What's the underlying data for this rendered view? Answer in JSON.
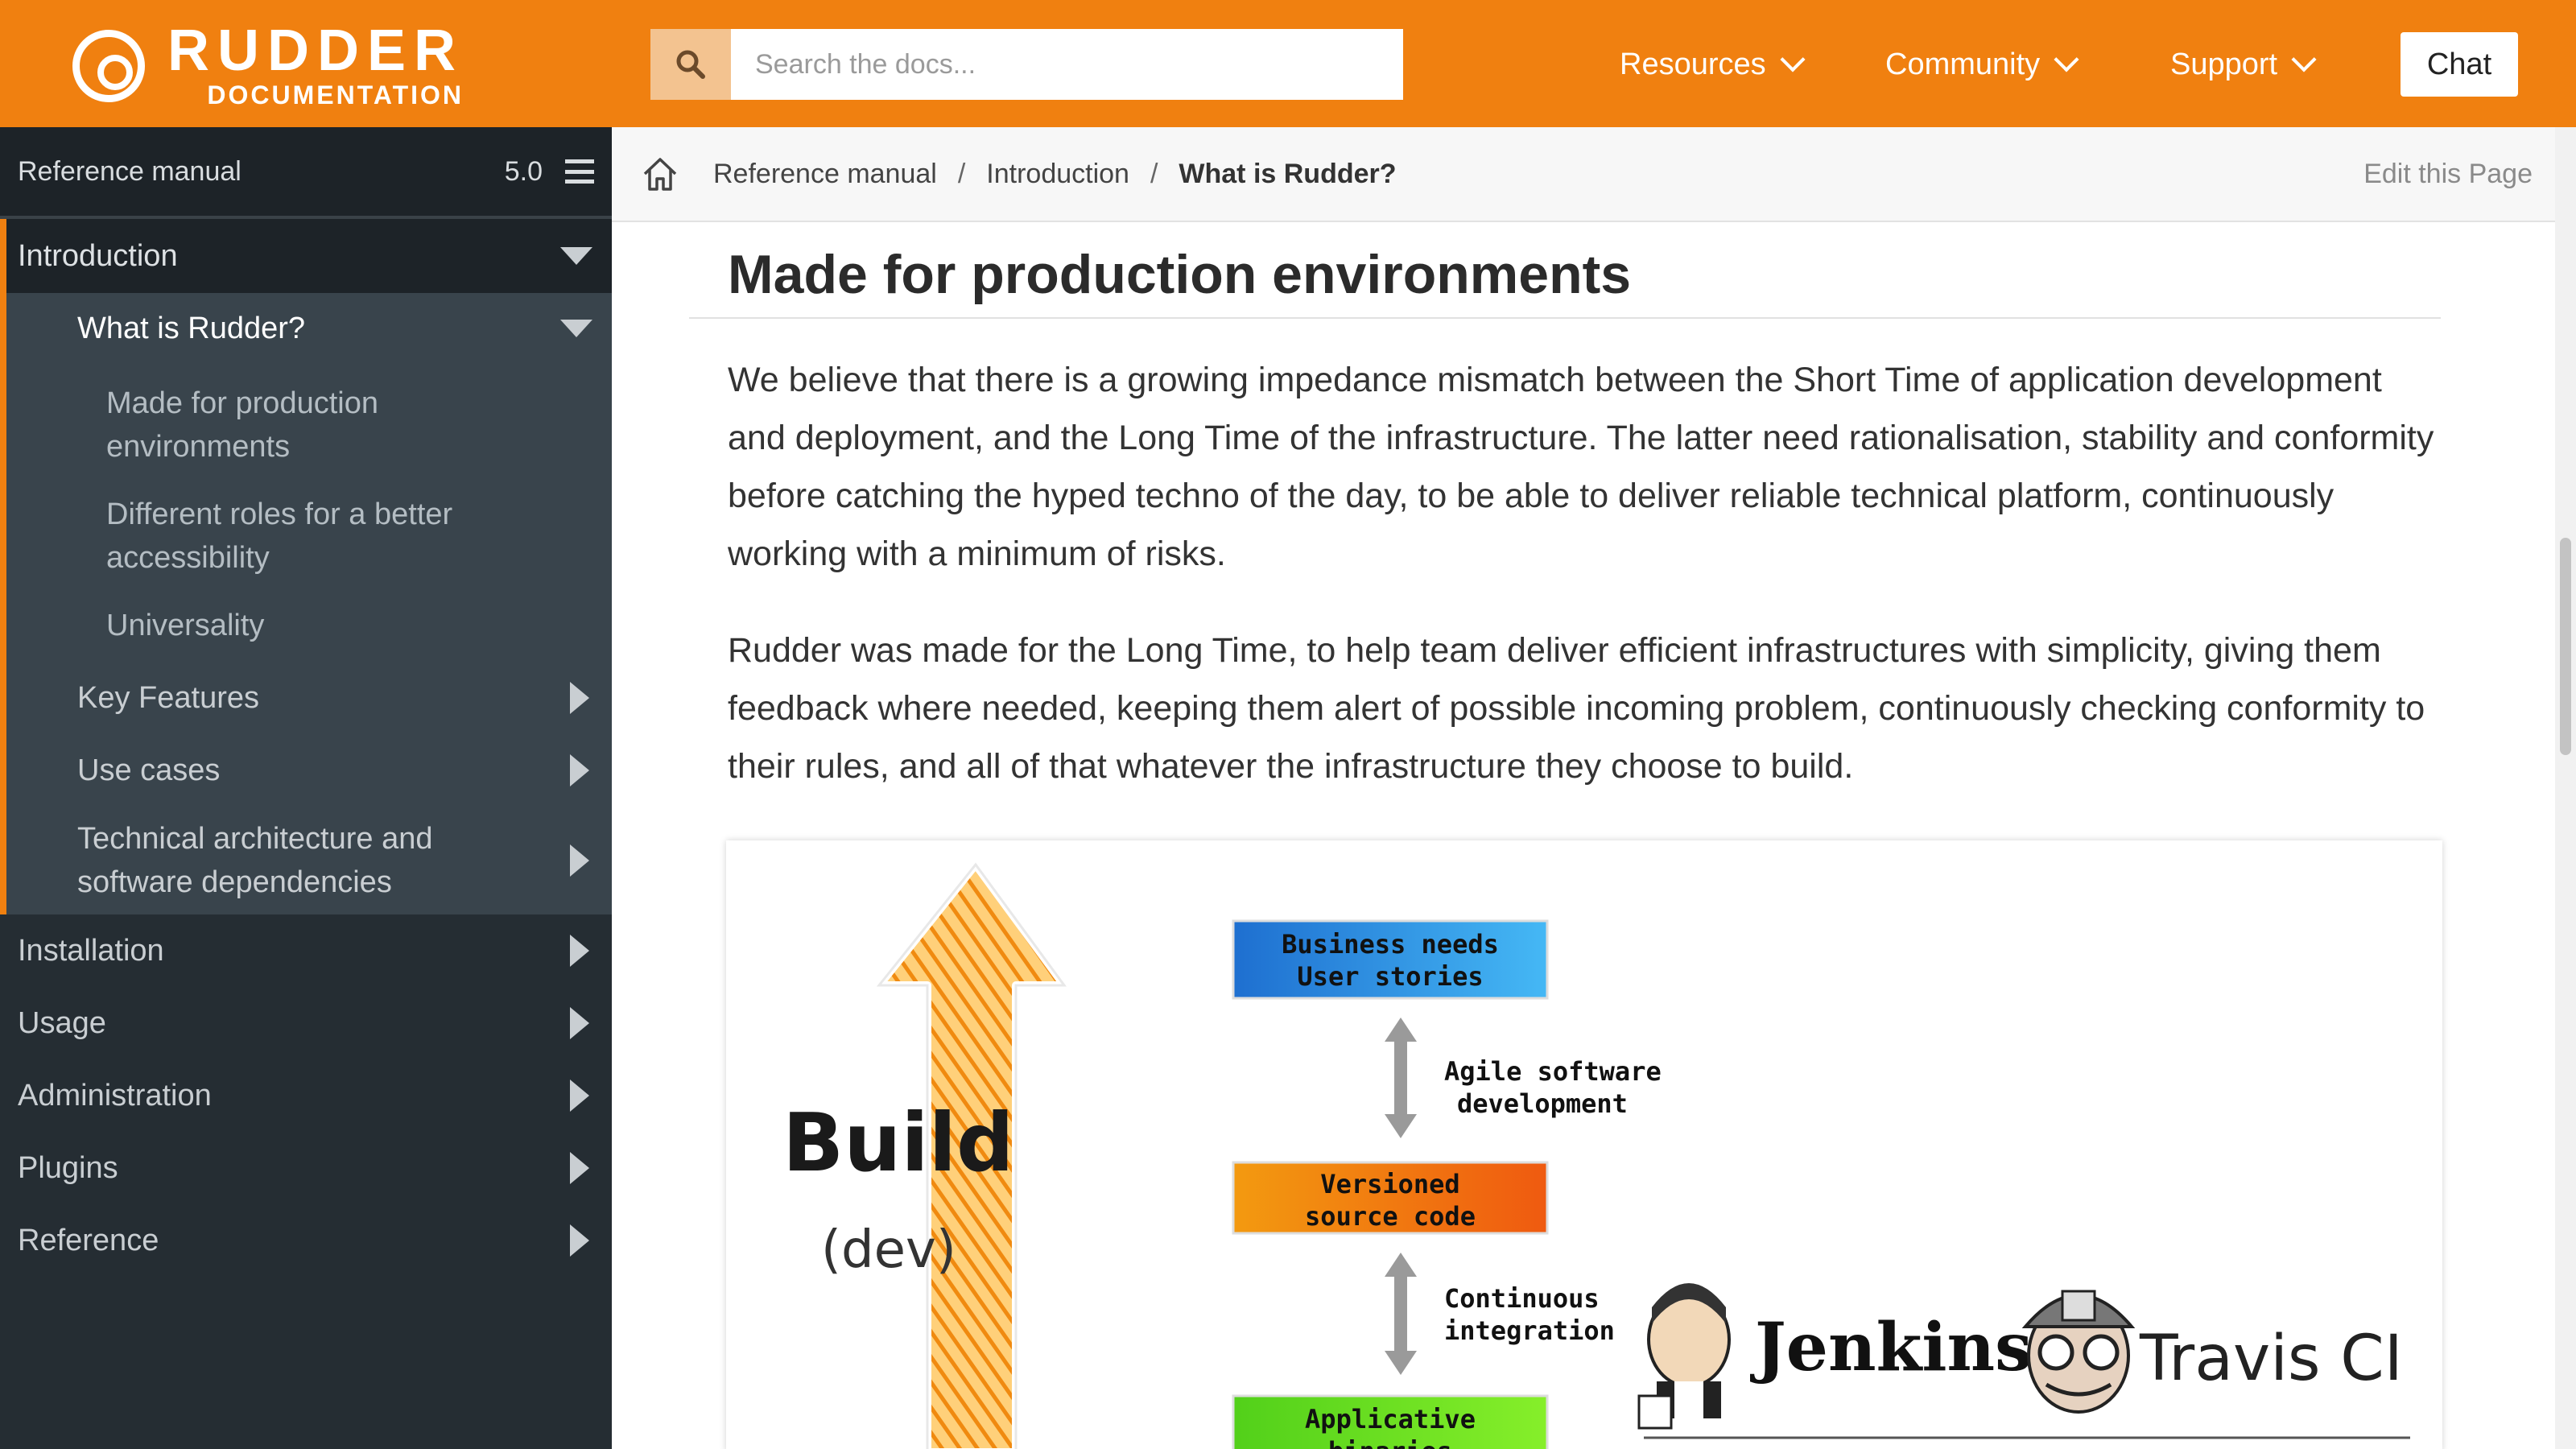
{
  "header": {
    "logo_title": "RUDDER",
    "logo_subtitle": "DOCUMENTATION",
    "search_placeholder": "Search the docs...",
    "nav": [
      {
        "label": "Resources"
      },
      {
        "label": "Community"
      },
      {
        "label": "Support"
      }
    ],
    "chat_label": "Chat",
    "accent_color": "#f08010"
  },
  "sidebar": {
    "manual_label": "Reference manual",
    "version": "5.0",
    "introduction": "Introduction",
    "what_is_rudder": "What is Rudder?",
    "sub_items": [
      "Made for production environments",
      "Different roles for a better accessibility",
      "Universality"
    ],
    "intro_children": [
      "Key Features",
      "Use cases",
      "Technical architecture and software dependencies"
    ],
    "top_items": [
      "Installation",
      "Usage",
      "Administration",
      "Plugins",
      "Reference"
    ]
  },
  "breadcrumb": {
    "items": [
      "Reference manual",
      "Introduction",
      "What is Rudder?"
    ],
    "separator": "/",
    "edit_label": "Edit this Page"
  },
  "content": {
    "heading": "Made for production environments",
    "paragraphs": [
      "We believe that there is a growing impedance mismatch between the Short Time of application develop­ment and deployment, and the Long Time of the infrastructure. The latter need rationalisation, stability and conformity before catching the hyped techno of the day, to be able to deliver reliable technical platform, continuously working with a minimum of risks.",
      "Rudder was made for the Long Time, to help team deliver efficient infrastructures with simplicity, giving them feedback where needed, keeping them alert of possible incoming problem, continuously checking conformity to their rules, and all of that whatever the infrastructure they choose to build."
    ]
  },
  "figure": {
    "build_label": "Build",
    "dev_label": "(dev)",
    "boxes": [
      {
        "line1": "Business needs",
        "line2": "User stories",
        "color": "#2b9be8"
      },
      {
        "line1": "Versioned",
        "line2": "source code",
        "color": "#f07a10"
      },
      {
        "line1": "Applicative",
        "line2": "binaries",
        "color": "#66dd22"
      }
    ],
    "steps": [
      {
        "line1": "Agile software",
        "line2": "development"
      },
      {
        "line1": "Continuous",
        "line2": "integration"
      }
    ],
    "logos": [
      "Jenkins",
      "Travis CI"
    ]
  }
}
